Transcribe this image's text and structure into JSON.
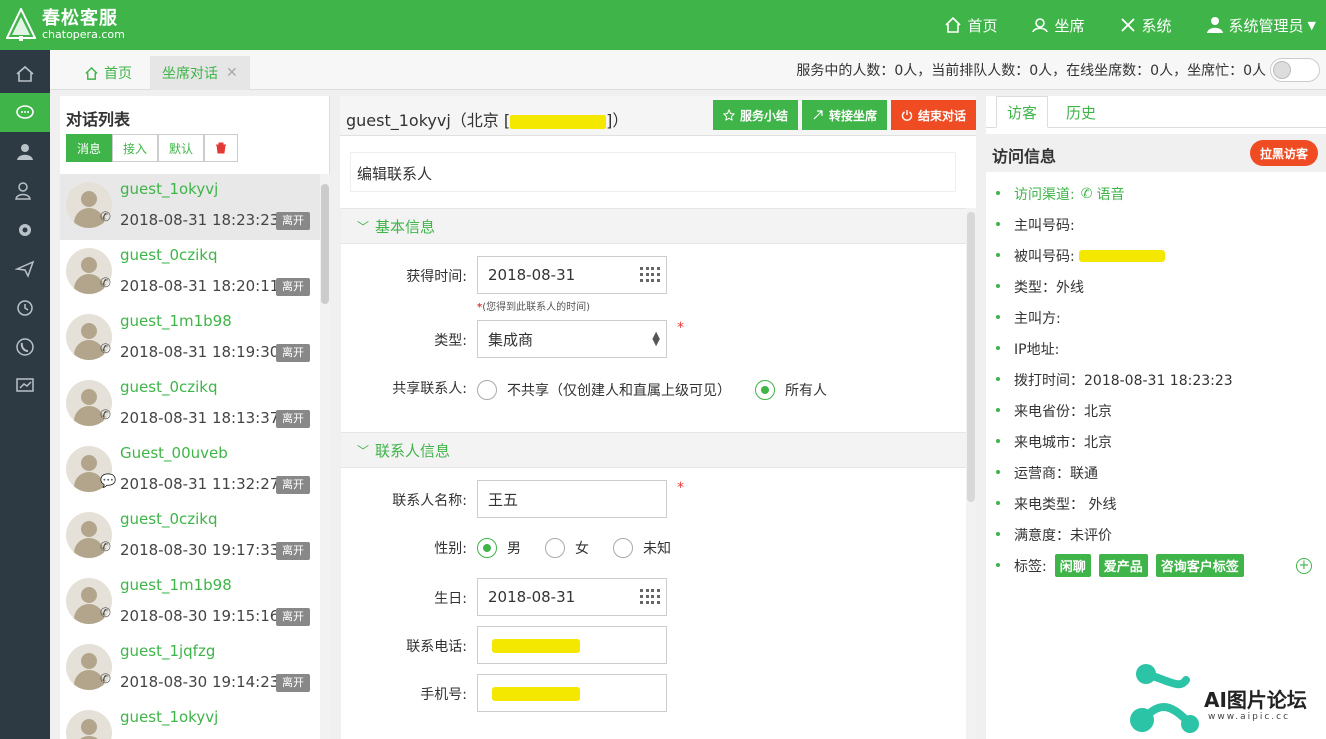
{
  "app": {
    "logo_cn": "春松客服",
    "logo_en": "chatopera.com",
    "nav": [
      "首页",
      "坐席",
      "系统",
      "系统管理员"
    ]
  },
  "tabs": {
    "home": "首页",
    "active": "坐席对话",
    "close": "✕"
  },
  "status_text": "服务中的人数：0人，当前排队人数：0人，在线坐席数：0人，坐席忙：0人",
  "conversation_panel": {
    "title": "对话列表",
    "filters": [
      "消息",
      "接入",
      "默认"
    ],
    "items": [
      {
        "name": "guest_1okyvj",
        "time": "2018-08-31 18:23:23",
        "status": "离开"
      },
      {
        "name": "guest_0czikq",
        "time": "2018-08-31 18:20:11",
        "status": "离开"
      },
      {
        "name": "guest_1m1b98",
        "time": "2018-08-31 18:19:30",
        "status": "离开"
      },
      {
        "name": "guest_0czikq",
        "time": "2018-08-31 18:13:37",
        "status": "离开"
      },
      {
        "name": "Guest_00uveb",
        "time": "2018-08-31 11:32:27",
        "status": "离开"
      },
      {
        "name": "guest_0czikq",
        "time": "2018-08-30 19:17:33",
        "status": "离开"
      },
      {
        "name": "guest_1m1b98",
        "time": "2018-08-30 19:15:16",
        "status": "离开"
      },
      {
        "name": "guest_1jqfzg",
        "time": "2018-08-30 19:14:23",
        "status": "离开"
      },
      {
        "name": "guest_1okyvj",
        "time": "",
        "status": ""
      }
    ]
  },
  "center": {
    "title_prefix": "guest_1okyvj（北京 [",
    "title_suffix": "]）",
    "actions": {
      "summary": "服务小结",
      "transfer": "转接坐席",
      "end": "结束对话"
    },
    "edit_title": "编辑联系人",
    "basic_section": "基本信息",
    "contact_section": "联系人信息",
    "fields": {
      "obtain_time_label": "获得时间:",
      "obtain_time_value": "2018-08-31",
      "obtain_time_hint": "(您得到此联系人的时间)",
      "type_label": "类型:",
      "type_value": "集成商",
      "share_label": "共享联系人:",
      "share_option_1": "不共享（仅创建人和直属上级可见）",
      "share_option_2": "所有人",
      "name_label": "联系人名称:",
      "name_value": "王五",
      "gender_label": "性别:",
      "gender_options": [
        "男",
        "女",
        "未知"
      ],
      "birthday_label": "生日:",
      "birthday_value": "2018-08-31",
      "phone_label": "联系电话:",
      "mobile_label": "手机号:"
    }
  },
  "right": {
    "tab_visitor": "访客",
    "tab_history": "历史",
    "title": "访问信息",
    "blacklist": "拉黑访客",
    "channel": "访问渠道:",
    "channel_value": "语音",
    "rows": {
      "caller": "主叫号码:",
      "callee": "被叫号码:",
      "type": "类型：外线",
      "calling_party": "主叫方:",
      "ip": "IP地址:",
      "dial_time": "拨打时间：2018-08-31 18:23:23",
      "province": "来电省份：北京",
      "city": "来电城市：北京",
      "carrier": "运营商：联通",
      "call_type": "来电类型： 外线",
      "satisfaction": "满意度：未评价",
      "tags_label": "标签:"
    },
    "tags": [
      "闲聊",
      "爱产品",
      "咨询客户标签"
    ]
  },
  "watermark": {
    "text": "AI图片论坛",
    "sub": "www.aipic.cc"
  },
  "colors": {
    "brand": "#3fb449",
    "danger": "#f04c23",
    "rail": "#2e3a43",
    "redact": "#f4e800"
  }
}
